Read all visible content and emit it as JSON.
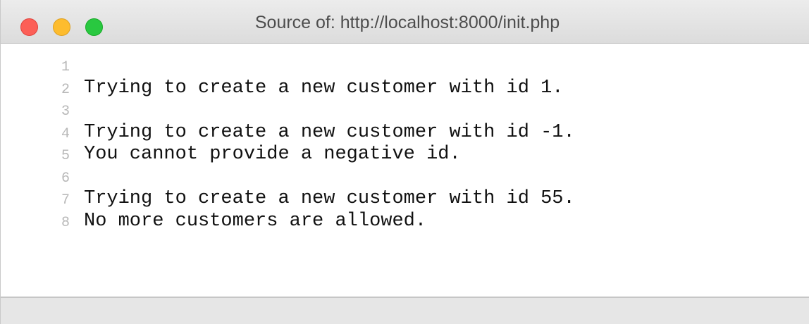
{
  "window": {
    "title": "Source of: http://localhost:8000/init.php"
  },
  "source": {
    "lines": [
      {
        "number": "1",
        "text": ""
      },
      {
        "number": "2",
        "text": "Trying to create a new customer with id 1."
      },
      {
        "number": "3",
        "text": ""
      },
      {
        "number": "4",
        "text": "Trying to create a new customer with id -1."
      },
      {
        "number": "5",
        "text": "You cannot provide a negative id."
      },
      {
        "number": "6",
        "text": ""
      },
      {
        "number": "7",
        "text": "Trying to create a new customer with id 55."
      },
      {
        "number": "8",
        "text": "No more customers are allowed."
      }
    ]
  },
  "colors": {
    "close": "#fc5f57",
    "minimize": "#fdbc2e",
    "zoom": "#29c840"
  }
}
